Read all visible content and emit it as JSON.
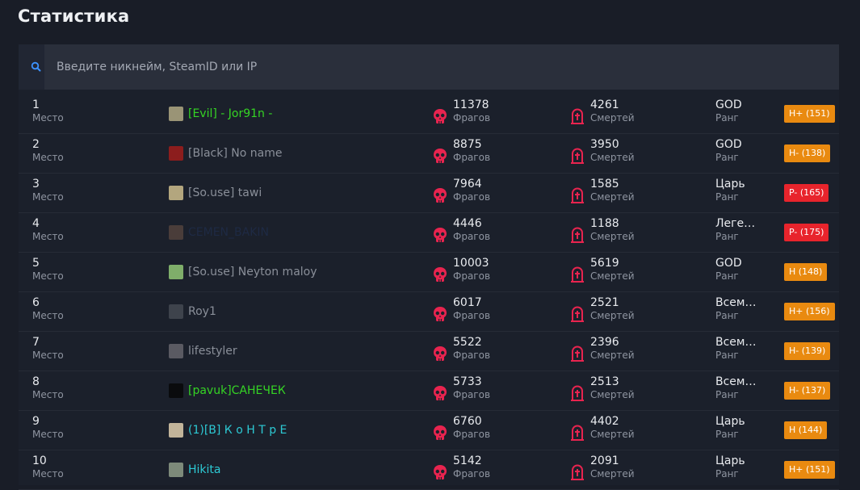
{
  "page": {
    "title": "Статистика"
  },
  "search": {
    "placeholder": "Введите никнейм, SteamID или IP"
  },
  "labels": {
    "place": "Место",
    "kills": "Фрагов",
    "deaths": "Смертей",
    "rank": "Ранг"
  },
  "colors": {
    "accent_icon": "#e8244f",
    "badge_orange": "#e98a10",
    "badge_red": "#e8242c",
    "name_gray": "#8a8f99",
    "name_green": "#35d424",
    "name_dark": "#1e2a44",
    "name_cyan": "#2dc9d4"
  },
  "players": [
    {
      "place": "1",
      "name": "[Evil] - Jor91n -",
      "name_color": "#35d424",
      "avatar_color": "#9a9476",
      "kills": "11378",
      "deaths": "4261",
      "rank": "GOD",
      "badge": "H+ (151)",
      "badge_color": "#e98a10"
    },
    {
      "place": "2",
      "name": "[Black] No name",
      "name_color": "#8a8f99",
      "avatar_color": "#8c1d1d",
      "kills": "8875",
      "deaths": "3950",
      "rank": "GOD",
      "badge": "H- (138)",
      "badge_color": "#e98a10"
    },
    {
      "place": "3",
      "name": "[So.use] tawi",
      "name_color": "#8a8f99",
      "avatar_color": "#b3a67e",
      "kills": "7964",
      "deaths": "1585",
      "rank": "Царь",
      "badge": "P- (165)",
      "badge_color": "#e8242c"
    },
    {
      "place": "4",
      "name": "CEMEN_BAKIN",
      "name_color": "#1e2a44",
      "avatar_color": "#4a3d3a",
      "kills": "4446",
      "deaths": "1188",
      "rank": "Легенда",
      "badge": "P- (175)",
      "badge_color": "#e8242c"
    },
    {
      "place": "5",
      "name": "[So.use] Neyton maloy",
      "name_color": "#8a8f99",
      "avatar_color": "#7fae6a",
      "kills": "10003",
      "deaths": "5619",
      "rank": "GOD",
      "badge": "H (148)",
      "badge_color": "#e98a10"
    },
    {
      "place": "6",
      "name": "Roy1",
      "name_color": "#8a8f99",
      "avatar_color": "#3e434c",
      "kills": "6017",
      "deaths": "2521",
      "rank": "Всемогущий",
      "badge": "H+ (156)",
      "badge_color": "#e98a10"
    },
    {
      "place": "7",
      "name": "lifestyler",
      "name_color": "#8a8f99",
      "avatar_color": "#5a5a62",
      "kills": "5522",
      "deaths": "2396",
      "rank": "Всемогущий",
      "badge": "H- (139)",
      "badge_color": "#e98a10"
    },
    {
      "place": "8",
      "name": "[pavuk]САНЕЧЕК",
      "name_color": "#35d424",
      "avatar_color": "#0a0b0d",
      "kills": "5733",
      "deaths": "2513",
      "rank": "Всемогущий",
      "badge": "H- (137)",
      "badge_color": "#e98a10"
    },
    {
      "place": "9",
      "name": "(1)[B] К о Н Т р Е",
      "name_color": "#2dc9d4",
      "avatar_color": "#c2b49a",
      "kills": "6760",
      "deaths": "4402",
      "rank": "Царь",
      "badge": "H (144)",
      "badge_color": "#e98a10"
    },
    {
      "place": "10",
      "name": "Hikita",
      "name_color": "#2dc9d4",
      "avatar_color": "#7d8a7a",
      "kills": "5142",
      "deaths": "2091",
      "rank": "Царь",
      "badge": "H+ (151)",
      "badge_color": "#e98a10"
    }
  ]
}
